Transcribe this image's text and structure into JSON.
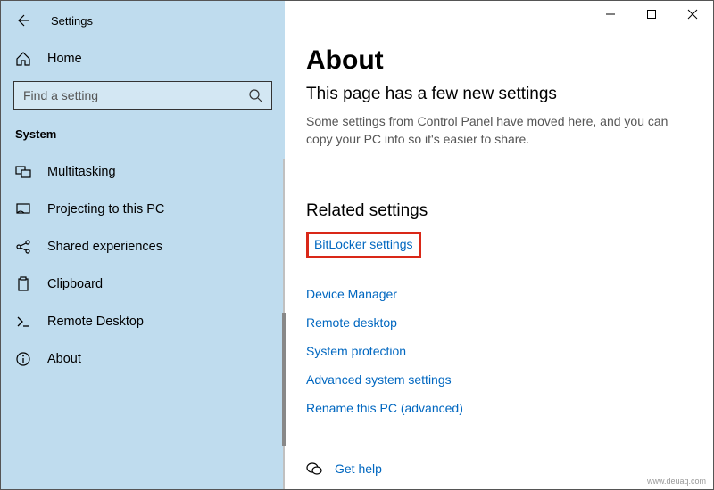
{
  "header": {
    "settings_label": "Settings"
  },
  "sidebar": {
    "home_label": "Home",
    "search_placeholder": "Find a setting",
    "section_label": "System",
    "items": [
      {
        "label": "Multitasking"
      },
      {
        "label": "Projecting to this PC"
      },
      {
        "label": "Shared experiences"
      },
      {
        "label": "Clipboard"
      },
      {
        "label": "Remote Desktop"
      },
      {
        "label": "About"
      }
    ]
  },
  "main": {
    "title": "About",
    "subtitle": "This page has a few new settings",
    "description": "Some settings from Control Panel have moved here, and you can copy your PC info so it's easier to share.",
    "related_title": "Related settings",
    "related_links": [
      {
        "label": "BitLocker settings",
        "highlighted": true
      },
      {
        "label": "Device Manager"
      },
      {
        "label": "Remote desktop"
      },
      {
        "label": "System protection"
      },
      {
        "label": "Advanced system settings"
      },
      {
        "label": "Rename this PC (advanced)"
      }
    ],
    "help_label": "Get help"
  },
  "watermark": "www.deuaq.com"
}
